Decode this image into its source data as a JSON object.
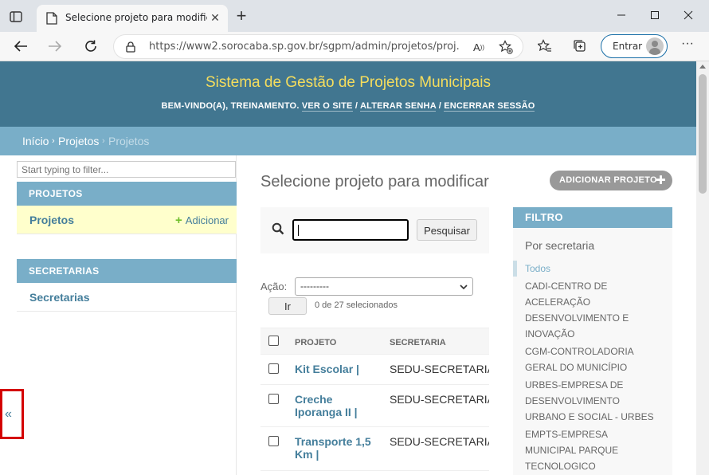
{
  "browser": {
    "tab_title": "Selecione projeto para modificar",
    "new_tab_symbol": "+",
    "url": "https://www2.sorocaba.sp.gov.br/sgpm/admin/projetos/proj...",
    "signin_label": "Entrar"
  },
  "header": {
    "site_title": "Sistema de Gestão de Projetos Municipais",
    "welcome": "BEM-VINDO(A), ",
    "username": "TREINAMENTO",
    "period": ". ",
    "links": [
      "VER O SITE",
      "ALTERAR SENHA",
      "ENCERRAR SESSÃO"
    ],
    "separator": " / "
  },
  "breadcrumbs": {
    "items": [
      "Início",
      "Projetos",
      "Projetos"
    ],
    "separator": "›"
  },
  "sidebar": {
    "filter_placeholder": "Start typing to filter...",
    "modules": [
      {
        "caption": "PROJETOS",
        "rows": [
          {
            "label": "Projetos",
            "add": "Adicionar"
          }
        ]
      },
      {
        "caption": "SECRETARIAS",
        "rows": [
          {
            "label": "Secretarias"
          }
        ]
      }
    ],
    "toggle": "«"
  },
  "content": {
    "title": "Selecione projeto para modificar",
    "add_button": "ADICIONAR PROJETO",
    "search": {
      "button": "Pesquisar",
      "value": ""
    },
    "actions": {
      "label": "Ação:",
      "selected": "---------",
      "go": "Ir",
      "counter": "0 de 27 selecionados"
    },
    "table": {
      "headers": [
        "PROJETO",
        "SECRETARIA"
      ],
      "rows": [
        {
          "projeto": "Kit Escolar |",
          "secretaria": "SEDU-SECRETARIA DA EDUCAÇÃO"
        },
        {
          "projeto": "Creche Iporanga II |",
          "secretaria": "SEDU-SECRETARIA DA EDUCAÇÃO"
        },
        {
          "projeto": "Transporte 1,5 Km |",
          "secretaria": "SEDU-SECRETARIA DA EDUCAÇÃO"
        }
      ]
    }
  },
  "filter": {
    "caption": "FILTRO",
    "subtitle": "Por secretaria",
    "items": [
      "Todos",
      "CADI-CENTRO DE",
      "ACELERAÇÃO",
      "DESENVOLVIMENTO E",
      "INOVAÇÃO",
      "CGM-CONTROLADORIA",
      "GERAL DO MUNICÍPIO",
      "URBES-EMPRESA DE",
      "DESENVOLVIMENTO",
      "URBANO E SOCIAL - URBES",
      "EMPTS-EMPRESA",
      "MUNICIPAL PARQUE",
      "TECNOLOGICO"
    ]
  },
  "colors": {
    "header_bg": "#417690",
    "title_yellow": "#f5dd5d",
    "accent_blue": "#79aec8",
    "link_blue": "#447e9b",
    "highlight_row": "#ffffcc",
    "add_green": "#70bf2b",
    "annotation_red": "#d40000"
  }
}
